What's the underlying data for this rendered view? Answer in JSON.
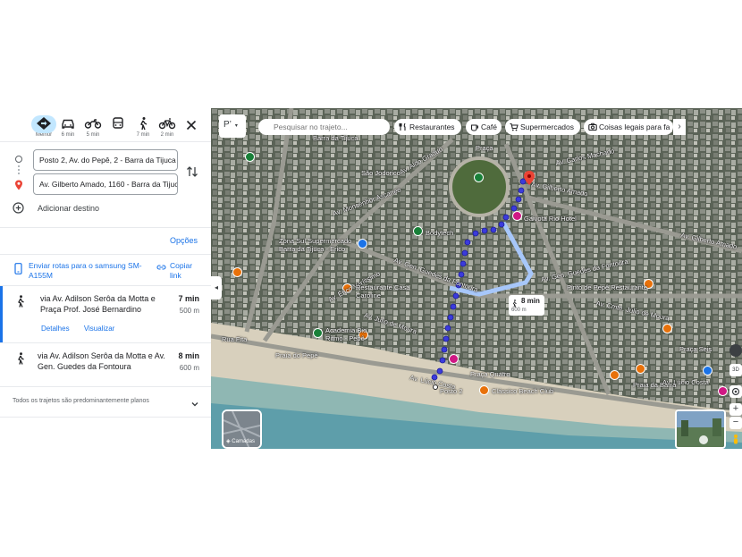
{
  "modes": [
    {
      "key": "best",
      "label": "Melhor",
      "icon": "diamond-directions-icon",
      "active": true
    },
    {
      "key": "car",
      "label": "6 min",
      "icon": "car-icon"
    },
    {
      "key": "moto",
      "label": "5 min",
      "icon": "motorcycle-icon"
    },
    {
      "key": "transit",
      "label": "",
      "icon": "bus-icon"
    },
    {
      "key": "walk",
      "label": "7 min",
      "icon": "walk-icon"
    },
    {
      "key": "bike",
      "label": "2 min",
      "icon": "bike-icon"
    }
  ],
  "origin": "Posto 2, Av. do Pepê, 2 - Barra da Tijuca",
  "destination": "Av. Gilberto Amado, 1160 - Barra da Tijuca",
  "add_destination": "Adicionar destino",
  "options_label": "Opções",
  "send_label": "Enviar rotas para o samsung SM-A155M",
  "copy_label": "Copiar link",
  "routes": [
    {
      "via": "via Av. Adilson Serôa da Motta e Praça Prof. José Bernardino",
      "time": "7 min",
      "distance": "500 m",
      "details": "Detalhes",
      "preview": "Visualizar"
    },
    {
      "via": "via Av. Adilson Serôa da Motta e Av. Gen. Guedes da Fontoura",
      "time": "8 min",
      "distance": "600 m"
    }
  ],
  "flat_note": "Todos os trajetos são predominantemente planos",
  "map": {
    "lang_label": "P’",
    "search_placeholder": "Pesquisar no trajeto...",
    "chips": [
      "Restaurantes",
      "Café",
      "Supermercados",
      "Coisas legais para fa"
    ],
    "route_box": {
      "time": "8 min",
      "distance": "600 m"
    },
    "layers_label": "Camadas",
    "labels": {
      "barra_tijuca": "Barra da Tijuca",
      "praca": "Praça",
      "carlos_machado": "Av. Carlos Machado",
      "aldo_graduo": "Av. Aldo Graduo",
      "sao_jodorico": "São Jodorico",
      "monsenhor": "Av. Monsenhor Ascaneo",
      "gilberto_amado": "Av. Gilberto Amado",
      "gilberto_amado_2": "Av. Gilberto Amado",
      "gaivota": "Gaivota Rio Hotel",
      "bodytech": "Bodytech",
      "zona_sul": "Zona Sul Supermercado Barra da Tijuca - Erico",
      "erico": "Av. Érico Veríssimo",
      "restaurante_casa": "Restaurante Casa Caroline",
      "guedes": "Av. Gen. Guedes da Fontoura",
      "guedes_2": "Av. Gen. Guedes da Fontoura",
      "julio": "Av. Julio de Moura",
      "pinto": "Pinto de Pepê Restaurante",
      "academia": "Academia Bio Ritmo - Pepê",
      "praia_pepe": "Praia do Pepê",
      "lucio": "Av. Lúcio Costa",
      "lucio_2": "Av. Lúcio Costa",
      "praca_quatro": "Praça Quatro",
      "posto2": "Posto 2",
      "classico": "Clássico Beach Club",
      "praca_seis": "Praça Seis",
      "praia_barra": "Praia da Barra",
      "cmte": "Av. Cmte. Júlio de Moura",
      "rua_fita": "Rua Fita"
    }
  }
}
